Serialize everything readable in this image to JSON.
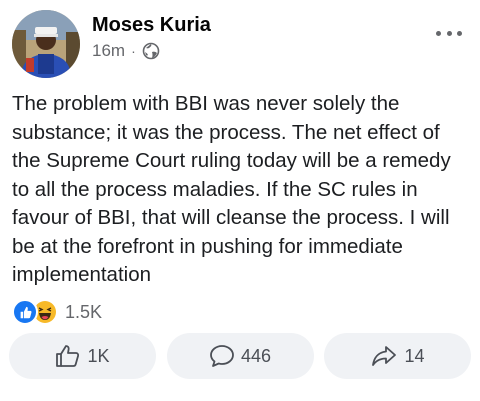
{
  "post": {
    "author": "Moses Kuria",
    "time": "16m",
    "separator": "·",
    "body": "The problem with BBI was never solely the substance; it was the process. The net effect of the Supreme Court ruling today will be a remedy to all the process maladies. If the SC rules in favour of BBI, that will cleanse the process. I will be at the forefront in pushing for immediate implementation",
    "reactions_count": "1.5K",
    "reaction_icons": [
      "like-icon",
      "haha-icon"
    ]
  },
  "actions": {
    "like_count": "1K",
    "comment_count": "446",
    "share_count": "14"
  },
  "colors": {
    "like_blue": "#1877f2",
    "haha_yellow": "#f7b928",
    "button_bg": "#f0f2f5",
    "muted_text": "#65676b"
  }
}
